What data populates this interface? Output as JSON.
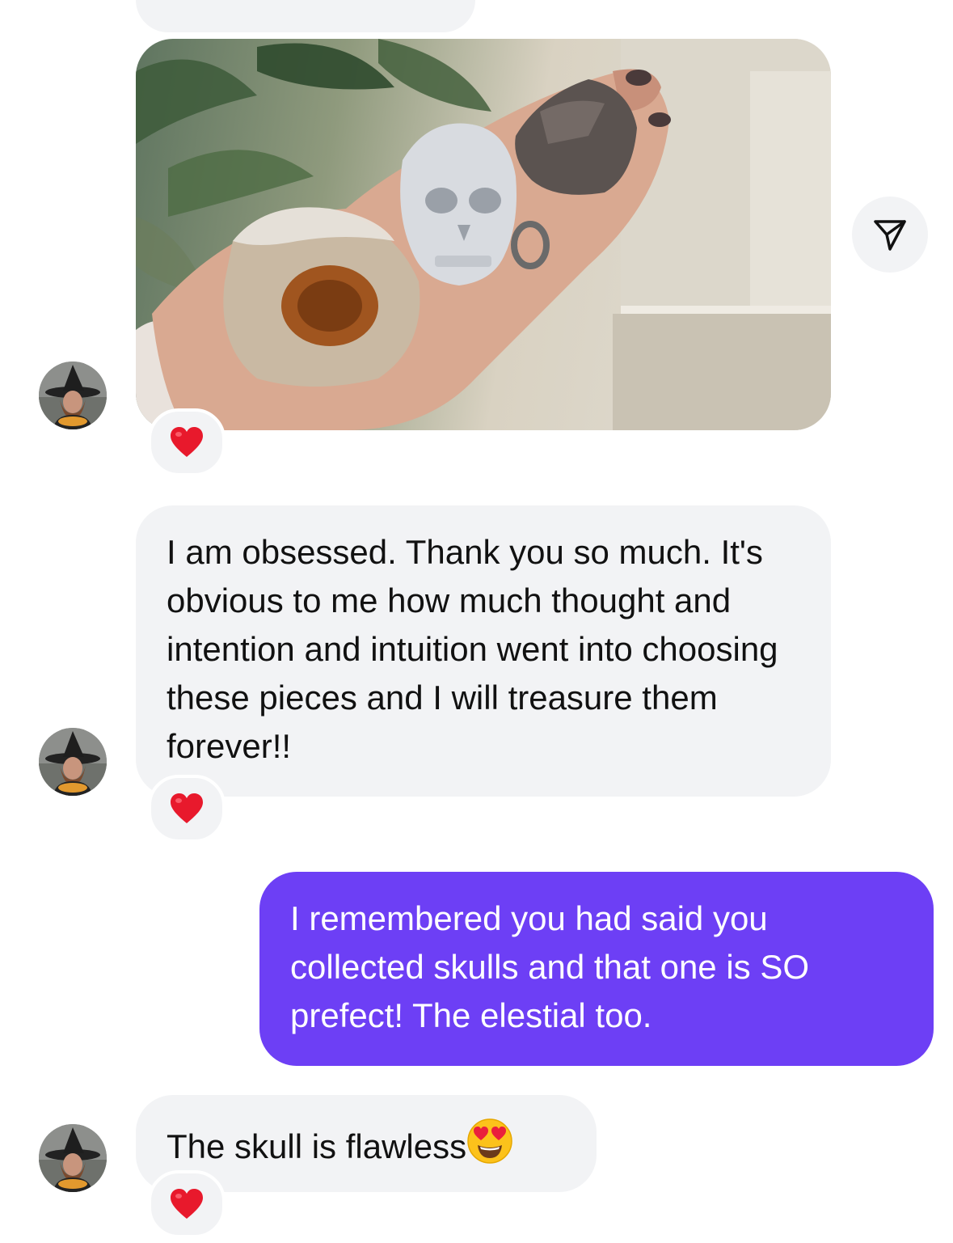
{
  "conversation": {
    "messages": [
      {
        "type": "image",
        "description": "photo",
        "reaction": "heart"
      },
      {
        "type": "text",
        "text": "I am obsessed. Thank you so much. It's obvious to me how much thought and intention and intuition went into choosing these pieces and I will treasure them forever!!",
        "reaction": "heart"
      },
      {
        "type": "text",
        "sender": "me",
        "text": "I remembered you had said you collected skulls and that one is SO prefect! The elestial too."
      },
      {
        "type": "text",
        "text": "The skull is flawless",
        "emoji": "heart-eyes-emoji",
        "reaction": "heart"
      }
    ]
  },
  "colors": {
    "incoming_bubble": "#f2f3f5",
    "outgoing_bubble": "#6d3ff5",
    "reaction_heart": "#e8192c"
  }
}
